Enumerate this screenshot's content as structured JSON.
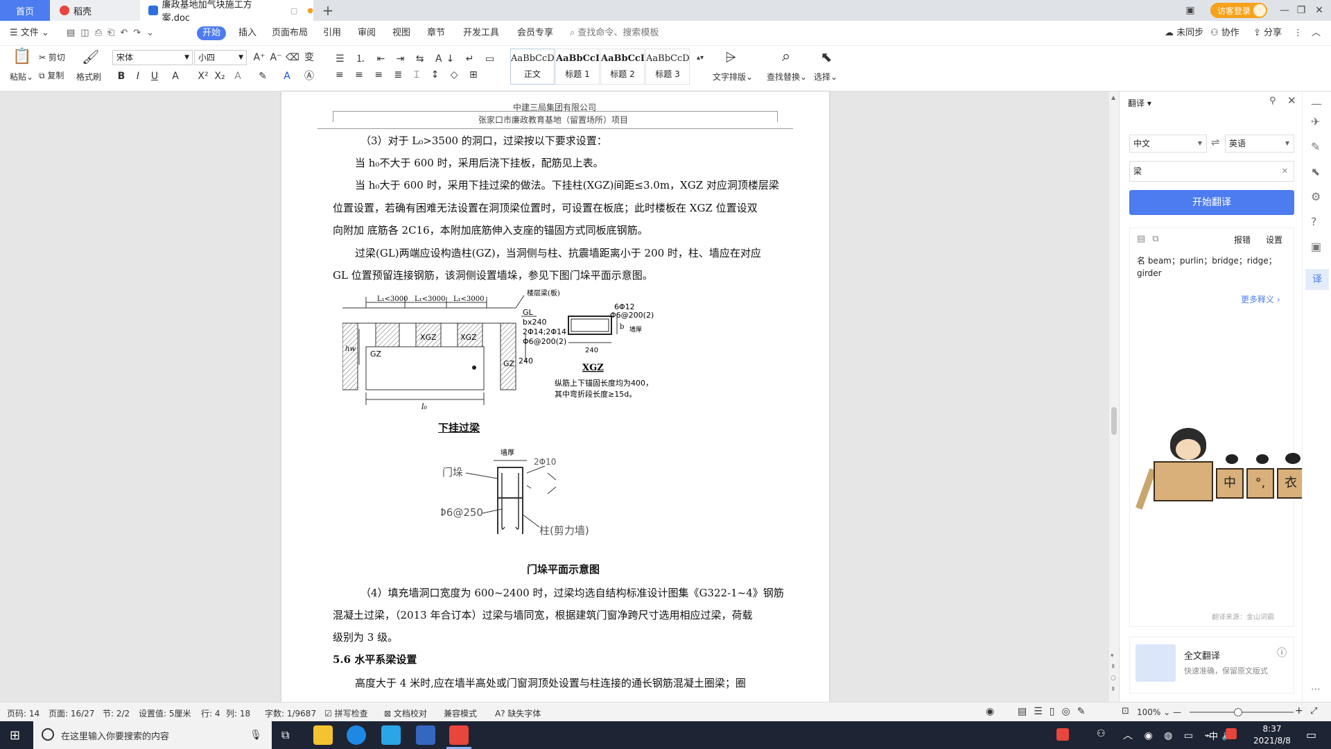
{
  "tabs": {
    "home": "首页",
    "daoke": "稻壳",
    "doc": "廉政基地加气块施工方案.doc"
  },
  "guest_login": "访客登录",
  "menu": {
    "file": "文件",
    "start": "开始",
    "insert": "插入",
    "layout": "页面布局",
    "reference": "引用",
    "review": "审阅",
    "view": "视图",
    "chapter": "章节",
    "devtools": "开发工具",
    "member": "会员专享",
    "search_placeholder": "查找命令、搜索模板",
    "unsynced": "未同步",
    "collab": "协作",
    "share": "分享"
  },
  "ribbon": {
    "paste": "粘贴",
    "cut": "剪切",
    "copy": "复制",
    "format_painter": "格式刷",
    "font_name": "宋体",
    "font_size": "小四",
    "styles": [
      {
        "sample": "AaBbCcDc",
        "label": "正文"
      },
      {
        "sample": "AaBbCcDc",
        "label": "标题 1"
      },
      {
        "sample": "AaBbCcDc",
        "label": "标题 2"
      },
      {
        "sample": "AaBbCcDc",
        "label": "标题 3"
      }
    ],
    "text_layout": "文字排版",
    "find_replace": "查找替换",
    "select": "选择"
  },
  "doc": {
    "header1": "中建三局集团有限公司",
    "header2": "张家口市廉政教育基地（留置场所）项目",
    "p1": "（3）对于 L₀>3500 的洞口，过梁按以下要求设置：",
    "p2": "当 h₀不大于 600 时，采用后浇下挂板，配筋见上表。",
    "p3a": "当 h₀大于 600 时，采用下挂过梁的做法。下挂柱(XGZ)间距≤3.0m，XGZ 对应洞顶楼层梁",
    "p3b": "位置设置，若确有困难无法设置在洞顶梁位置时，可设置在板底；此时楼板在 XGZ 位置设双",
    "p3c": "向附加      底筋各 2C16，本附加底筋伸入支座的锚固方式同板底钢筋。",
    "p4a": "过梁(GL)两端应设构造柱(GZ)，当洞侧与柱、抗震墙距离小于 200 时，柱、墙应在对应",
    "p4b": "GL 位置预留连接钢筋，该洞侧设置墙垛，参见下图门垛平面示意图。",
    "fig1": {
      "lt1": "L₁<3000",
      "lt2": "L₁<3000",
      "lt3": "L₁<3000",
      "slab": "楼层梁(板)",
      "gl_spec": "GL\nbx240\n2Φ14;2Φ14\nΦ6@200(2)",
      "gl_spec_lines": [
        "GL",
        "bx240",
        "2Φ14;2Φ14",
        "Φ6@200(2)"
      ],
      "xgz1": "XGZ",
      "xgz2": "XGZ",
      "gz1": "GZ",
      "gz2": "GZ",
      "hw": "hw",
      "dim240": "240",
      "l0": "l₀",
      "xgz_top1": "6Φ12",
      "xgz_top2": "Φ6@200(2)",
      "xgz_w": "240",
      "xgz_b": "b",
      "xgz_wall": "墙厚",
      "xgz_label": "XGZ",
      "xgz_note1": "纵筋上下锚固长度均为400，",
      "xgz_note2": "其中弯折段长度≥15d。",
      "caption": "下挂过梁"
    },
    "fig2": {
      "wall": "墙厚",
      "rebar": "2Φ10",
      "door": "门垛",
      "stirrup": "Φ6@250",
      "column": "柱(剪力墙)",
      "caption": "门垛平面示意图"
    },
    "p5a": "（4）填充墙洞口宽度为 600~2400 时，过梁均选自结构标准设计图集《G322-1~4》钢筋",
    "p5b": "混凝土过梁，（2013 年合订本）过梁与墙同宽，根据建筑门窗净跨尺寸选用相应过梁，荷载",
    "p5c": "级别为 3 级。",
    "h56": "5.6 水平系梁设置",
    "p6a": "高度大于 4 米时,应在墙半高处或门窗洞顶处设置与柱连接的通长钢筋混凝土圈梁；圈"
  },
  "panel": {
    "title": "翻译",
    "src_lang": "中文",
    "dst_lang": "英语",
    "input": "梁",
    "start_btn": "开始翻译",
    "report": "报错",
    "settings": "设置",
    "result": "名 beam；purlin；bridge；ridge；girder",
    "more": "更多释义",
    "source": "翻译来源：金山词霸",
    "full_title": "全文翻译",
    "full_sub": "快速准确，保留原文版式",
    "mascot_tags": [
      "中",
      "°,",
      "衣"
    ]
  },
  "status": {
    "page_no": "页码: 14",
    "pages": "页面: 16/27",
    "section": "节: 2/2",
    "setting": "设置值: 5厘米",
    "row": "行: 4",
    "col": "列: 18",
    "words": "字数: 1/9687",
    "spell": "拼写检查",
    "proof": "文档校对",
    "compat": "兼容模式",
    "missing_font": "缺失字体",
    "zoom": "100%"
  },
  "taskbar": {
    "search": "在这里输入你要搜索的内容",
    "time": "8:37",
    "date": "2021/8/8",
    "ime": "中"
  },
  "colors": {
    "accent": "#4c7cf0",
    "orange": "#f7a21b",
    "taskbar": "#1d2433"
  }
}
